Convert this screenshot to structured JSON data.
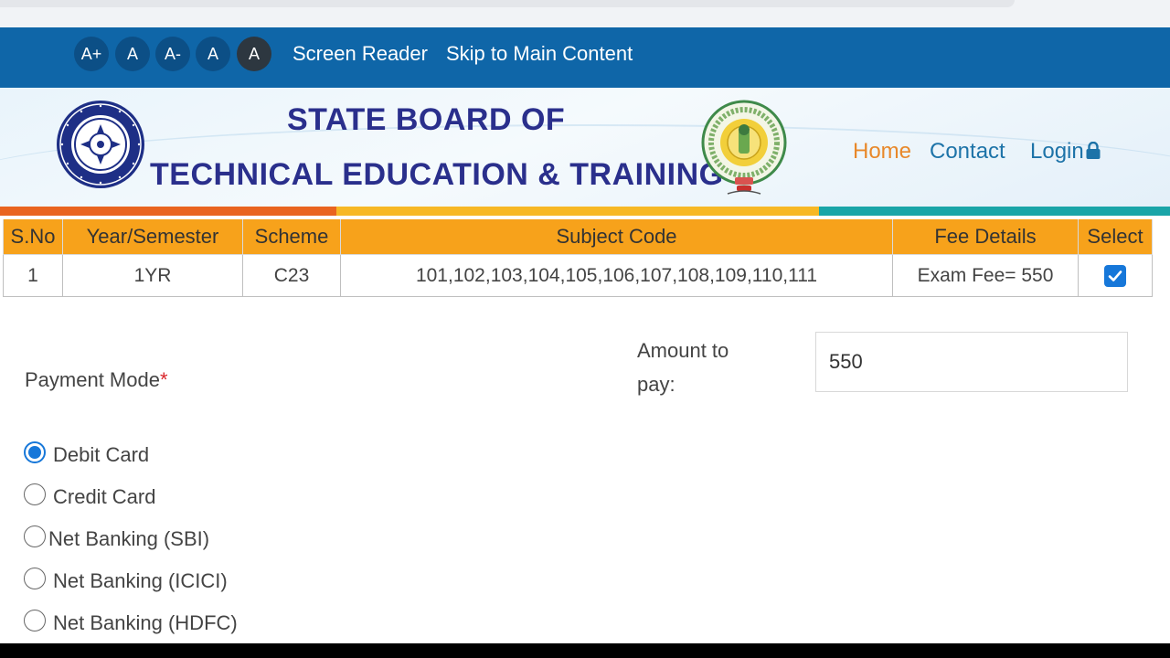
{
  "accessibility": {
    "font_buttons": [
      "A+",
      "A",
      "A-",
      "A",
      "A"
    ],
    "screen_reader": "Screen Reader",
    "skip_link": "Skip to Main Content"
  },
  "header": {
    "title_line1": "STATE BOARD OF",
    "title_line2": "TECHNICAL EDUCATION & TRAINING",
    "nav": {
      "home": "Home",
      "contact": "Contact",
      "login": "Login"
    }
  },
  "subject_table": {
    "headers": [
      "S.No",
      "Year/Semester",
      "Scheme",
      "Subject Code",
      "Fee Details",
      "Select"
    ],
    "rows": [
      {
        "sno": "1",
        "year_semester": "1YR",
        "scheme": "C23",
        "subject_code": "101,102,103,104,105,106,107,108,109,110,111",
        "fee_details": "Exam Fee= 550",
        "selected": true
      }
    ]
  },
  "payment": {
    "label": "Payment Mode",
    "required_marker": "*",
    "amount_label": "Amount to pay:",
    "amount_value": "550",
    "options": [
      {
        "label": "Debit Card",
        "checked": true
      },
      {
        "label": "Credit Card",
        "checked": false
      },
      {
        "label": "Net Banking (SBI)",
        "checked": false
      },
      {
        "label": "Net Banking (ICICI)",
        "checked": false
      },
      {
        "label": "Net Banking (HDFC)",
        "checked": false
      }
    ]
  },
  "colors": {
    "access_bar": "#0f66a8",
    "title": "#2a2f8c",
    "table_header": "#f7a21b",
    "nav_home": "#e8882a",
    "nav_link": "#1d73a8",
    "accent_blue": "#1677d9"
  },
  "icons": {
    "login": "lock-icon",
    "select": "checkbox-checked-icon",
    "logo_left": "sbtet-emblem-logo",
    "logo_right": "andhra-pradesh-state-emblem-logo"
  }
}
